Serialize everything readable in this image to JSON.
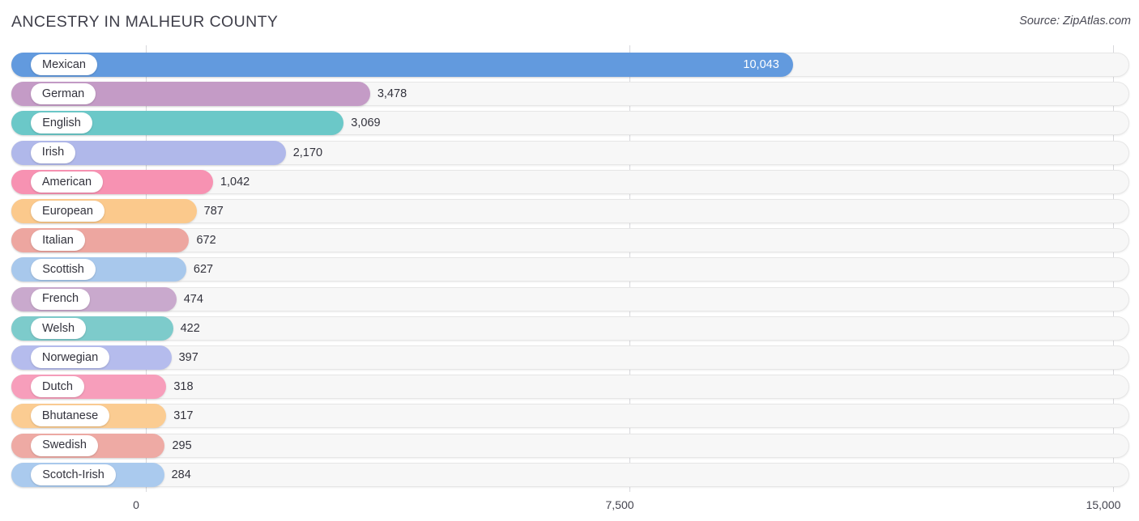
{
  "header": {
    "title": "ANCESTRY IN MALHEUR COUNTY",
    "source": "Source: ZipAtlas.com"
  },
  "chart_data": {
    "type": "bar",
    "orientation": "horizontal",
    "title": "ANCESTRY IN MALHEUR COUNTY",
    "xlabel": "",
    "ylabel": "",
    "xlim": [
      0,
      15000
    ],
    "grid": true,
    "legend": "none",
    "axis_ticks": [
      "0",
      "7,500",
      "15,000"
    ],
    "axis_tick_values": [
      0,
      7500,
      15000
    ],
    "categories": [
      "Mexican",
      "German",
      "English",
      "Irish",
      "American",
      "European",
      "Italian",
      "Scottish",
      "French",
      "Welsh",
      "Norwegian",
      "Dutch",
      "Bhutanese",
      "Swedish",
      "Scotch-Irish"
    ],
    "values": [
      10043,
      3478,
      3069,
      2170,
      1042,
      787,
      672,
      627,
      474,
      422,
      397,
      318,
      317,
      295,
      284
    ],
    "value_labels": [
      "10,043",
      "3,478",
      "3,069",
      "2,170",
      "1,042",
      "787",
      "672",
      "627",
      "474",
      "422",
      "397",
      "318",
      "317",
      "295",
      "284"
    ],
    "colors": [
      "#629ade",
      "#c49bc6",
      "#6bc8c8",
      "#b0b8ea",
      "#f792b2",
      "#fbc98c",
      "#eda6a0",
      "#a8c8ec",
      "#c9a9cd",
      "#7dcbcb",
      "#b5bced",
      "#f79ebb",
      "#fbcc92",
      "#eeaaa4",
      "#aacaee"
    ],
    "value_inside_bar": [
      true,
      false,
      false,
      false,
      false,
      false,
      false,
      false,
      false,
      false,
      false,
      false,
      false,
      false,
      false
    ]
  }
}
